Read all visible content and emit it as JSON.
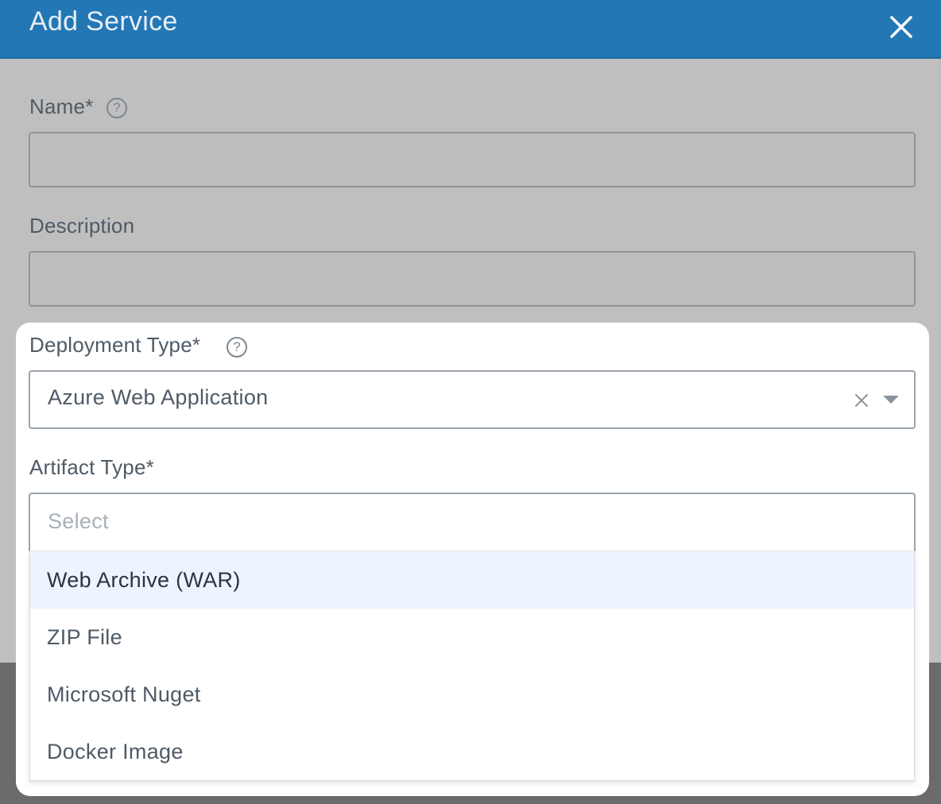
{
  "dialog": {
    "title": "Add Service",
    "close_icon": "close-icon"
  },
  "fields": {
    "name": {
      "label": "Name*",
      "help_icon": "question-circle-icon",
      "value": ""
    },
    "description": {
      "label": "Description",
      "value": ""
    },
    "deployment_type": {
      "label": "Deployment Type*",
      "help_icon": "question-circle-icon",
      "value": "Azure Web Application",
      "clear_icon": "clear-x-icon",
      "caret_icon": "caret-down-icon"
    },
    "artifact_type": {
      "label": "Artifact Type*",
      "placeholder": "Select",
      "options": [
        {
          "label": "Web Archive (WAR)",
          "highlighted": true
        },
        {
          "label": "ZIP File",
          "highlighted": false
        },
        {
          "label": "Microsoft Nuget",
          "highlighted": false
        },
        {
          "label": "Docker Image",
          "highlighted": false
        }
      ]
    }
  },
  "colors": {
    "header": "#2377b5",
    "overlay": "#bfbfbf",
    "highlight": "#edf4fd",
    "text": "#4e5a66"
  }
}
